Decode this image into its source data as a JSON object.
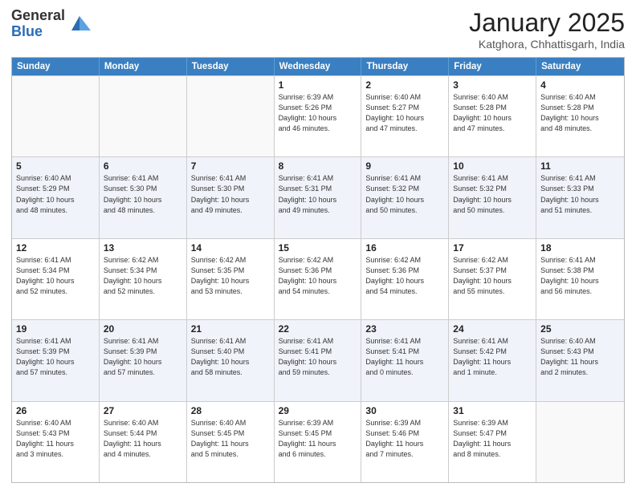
{
  "logo": {
    "general": "General",
    "blue": "Blue"
  },
  "header": {
    "month": "January 2025",
    "location": "Katghora, Chhattisgarh, India"
  },
  "weekdays": [
    "Sunday",
    "Monday",
    "Tuesday",
    "Wednesday",
    "Thursday",
    "Friday",
    "Saturday"
  ],
  "weeks": [
    [
      {
        "day": "",
        "detail": ""
      },
      {
        "day": "",
        "detail": ""
      },
      {
        "day": "",
        "detail": ""
      },
      {
        "day": "1",
        "detail": "Sunrise: 6:39 AM\nSunset: 5:26 PM\nDaylight: 10 hours\nand 46 minutes."
      },
      {
        "day": "2",
        "detail": "Sunrise: 6:40 AM\nSunset: 5:27 PM\nDaylight: 10 hours\nand 47 minutes."
      },
      {
        "day": "3",
        "detail": "Sunrise: 6:40 AM\nSunset: 5:28 PM\nDaylight: 10 hours\nand 47 minutes."
      },
      {
        "day": "4",
        "detail": "Sunrise: 6:40 AM\nSunset: 5:28 PM\nDaylight: 10 hours\nand 48 minutes."
      }
    ],
    [
      {
        "day": "5",
        "detail": "Sunrise: 6:40 AM\nSunset: 5:29 PM\nDaylight: 10 hours\nand 48 minutes."
      },
      {
        "day": "6",
        "detail": "Sunrise: 6:41 AM\nSunset: 5:30 PM\nDaylight: 10 hours\nand 48 minutes."
      },
      {
        "day": "7",
        "detail": "Sunrise: 6:41 AM\nSunset: 5:30 PM\nDaylight: 10 hours\nand 49 minutes."
      },
      {
        "day": "8",
        "detail": "Sunrise: 6:41 AM\nSunset: 5:31 PM\nDaylight: 10 hours\nand 49 minutes."
      },
      {
        "day": "9",
        "detail": "Sunrise: 6:41 AM\nSunset: 5:32 PM\nDaylight: 10 hours\nand 50 minutes."
      },
      {
        "day": "10",
        "detail": "Sunrise: 6:41 AM\nSunset: 5:32 PM\nDaylight: 10 hours\nand 50 minutes."
      },
      {
        "day": "11",
        "detail": "Sunrise: 6:41 AM\nSunset: 5:33 PM\nDaylight: 10 hours\nand 51 minutes."
      }
    ],
    [
      {
        "day": "12",
        "detail": "Sunrise: 6:41 AM\nSunset: 5:34 PM\nDaylight: 10 hours\nand 52 minutes."
      },
      {
        "day": "13",
        "detail": "Sunrise: 6:42 AM\nSunset: 5:34 PM\nDaylight: 10 hours\nand 52 minutes."
      },
      {
        "day": "14",
        "detail": "Sunrise: 6:42 AM\nSunset: 5:35 PM\nDaylight: 10 hours\nand 53 minutes."
      },
      {
        "day": "15",
        "detail": "Sunrise: 6:42 AM\nSunset: 5:36 PM\nDaylight: 10 hours\nand 54 minutes."
      },
      {
        "day": "16",
        "detail": "Sunrise: 6:42 AM\nSunset: 5:36 PM\nDaylight: 10 hours\nand 54 minutes."
      },
      {
        "day": "17",
        "detail": "Sunrise: 6:42 AM\nSunset: 5:37 PM\nDaylight: 10 hours\nand 55 minutes."
      },
      {
        "day": "18",
        "detail": "Sunrise: 6:41 AM\nSunset: 5:38 PM\nDaylight: 10 hours\nand 56 minutes."
      }
    ],
    [
      {
        "day": "19",
        "detail": "Sunrise: 6:41 AM\nSunset: 5:39 PM\nDaylight: 10 hours\nand 57 minutes."
      },
      {
        "day": "20",
        "detail": "Sunrise: 6:41 AM\nSunset: 5:39 PM\nDaylight: 10 hours\nand 57 minutes."
      },
      {
        "day": "21",
        "detail": "Sunrise: 6:41 AM\nSunset: 5:40 PM\nDaylight: 10 hours\nand 58 minutes."
      },
      {
        "day": "22",
        "detail": "Sunrise: 6:41 AM\nSunset: 5:41 PM\nDaylight: 10 hours\nand 59 minutes."
      },
      {
        "day": "23",
        "detail": "Sunrise: 6:41 AM\nSunset: 5:41 PM\nDaylight: 11 hours\nand 0 minutes."
      },
      {
        "day": "24",
        "detail": "Sunrise: 6:41 AM\nSunset: 5:42 PM\nDaylight: 11 hours\nand 1 minute."
      },
      {
        "day": "25",
        "detail": "Sunrise: 6:40 AM\nSunset: 5:43 PM\nDaylight: 11 hours\nand 2 minutes."
      }
    ],
    [
      {
        "day": "26",
        "detail": "Sunrise: 6:40 AM\nSunset: 5:43 PM\nDaylight: 11 hours\nand 3 minutes."
      },
      {
        "day": "27",
        "detail": "Sunrise: 6:40 AM\nSunset: 5:44 PM\nDaylight: 11 hours\nand 4 minutes."
      },
      {
        "day": "28",
        "detail": "Sunrise: 6:40 AM\nSunset: 5:45 PM\nDaylight: 11 hours\nand 5 minutes."
      },
      {
        "day": "29",
        "detail": "Sunrise: 6:39 AM\nSunset: 5:45 PM\nDaylight: 11 hours\nand 6 minutes."
      },
      {
        "day": "30",
        "detail": "Sunrise: 6:39 AM\nSunset: 5:46 PM\nDaylight: 11 hours\nand 7 minutes."
      },
      {
        "day": "31",
        "detail": "Sunrise: 6:39 AM\nSunset: 5:47 PM\nDaylight: 11 hours\nand 8 minutes."
      },
      {
        "day": "",
        "detail": ""
      }
    ]
  ]
}
